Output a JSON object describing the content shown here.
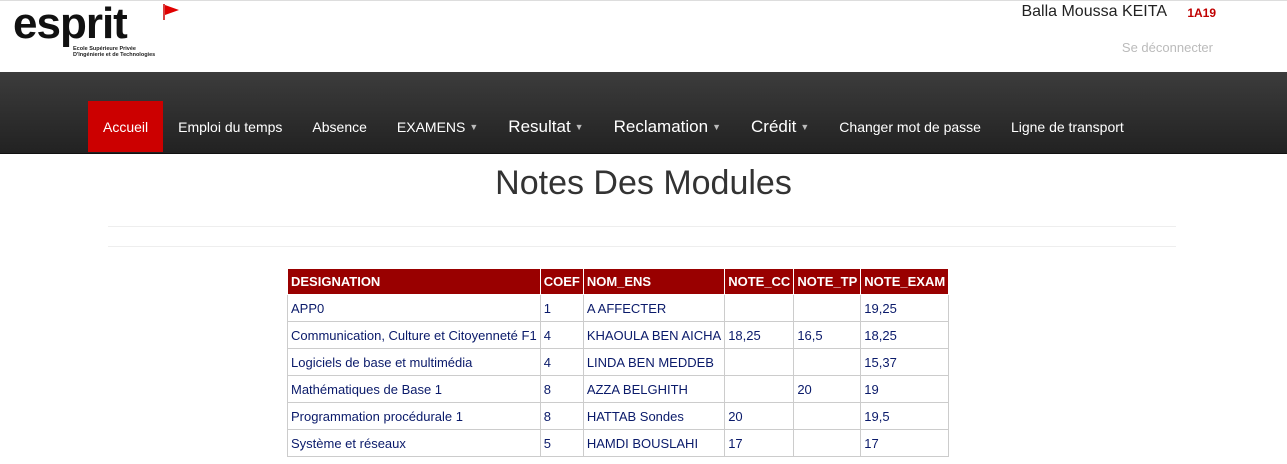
{
  "header": {
    "logo_text": "esprit",
    "logo_subtitle": [
      "Ecole Supérieure Privée",
      "D'Ingénierie et de Technologies"
    ],
    "user_name": "Balla Moussa KEITA",
    "user_class": "1A19",
    "logout_label": "Se déconnecter"
  },
  "nav": {
    "items": [
      {
        "label": "Accueil"
      },
      {
        "label": "Emploi du temps"
      },
      {
        "label": "Absence"
      },
      {
        "label": "EXAMENS"
      },
      {
        "label": "Resultat"
      },
      {
        "label": "Reclamation"
      },
      {
        "label": "Crédit"
      },
      {
        "label": "Changer mot de passe"
      },
      {
        "label": "Ligne de transport"
      }
    ]
  },
  "main": {
    "title": "Notes Des Modules",
    "table": {
      "headers": [
        "DESIGNATION",
        "COEF",
        "NOM_ENS",
        "NOTE_CC",
        "NOTE_TP",
        "NOTE_EXAM"
      ],
      "rows": [
        [
          "APP0",
          "1",
          "A AFFECTER",
          "",
          "",
          "19,25"
        ],
        [
          "Communication, Culture et Citoyenneté F1",
          "4",
          "KHAOULA BEN AICHA",
          "18,25",
          "16,5",
          "18,25"
        ],
        [
          "Logiciels de base et multimédia",
          "4",
          "LINDA BEN MEDDEB",
          "",
          "",
          "15,37"
        ],
        [
          "Mathématiques de Base 1",
          "8",
          "AZZA BELGHITH",
          "",
          "20",
          "19"
        ],
        [
          "Programmation procédurale 1",
          "8",
          "HATTAB Sondes",
          "20",
          "",
          "19,5"
        ],
        [
          "Système et réseaux",
          "5",
          "HAMDI BOUSLAHI",
          "17",
          "",
          "17"
        ]
      ]
    }
  },
  "colors": {
    "accent": "#cc0000",
    "table_header": "#990000",
    "navbar": "#2b2b2b",
    "table_text": "#0a1a6a"
  }
}
